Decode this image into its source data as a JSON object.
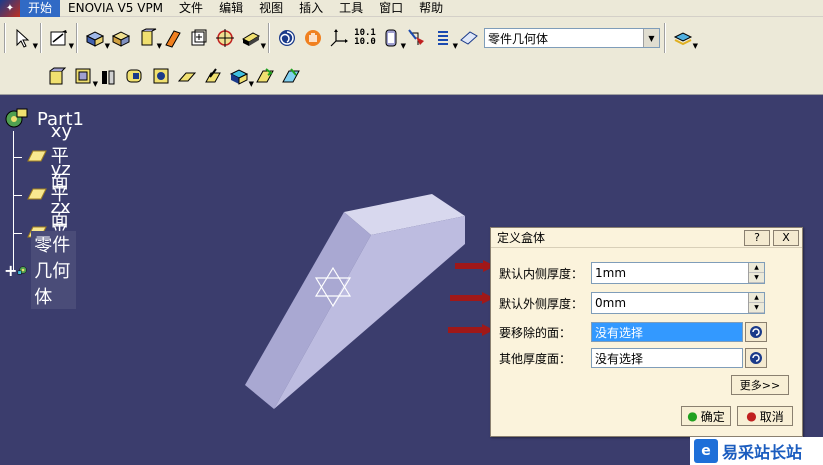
{
  "menubar": {
    "items": [
      "开始",
      "ENOVIA V5 VPM",
      "文件",
      "编辑",
      "视图",
      "插入",
      "工具",
      "窗口",
      "帮助"
    ]
  },
  "toolbar": {
    "text_icon_top": "10.1",
    "text_icon_bottom": "10.0",
    "body_combo_value": "零件几何体"
  },
  "tree": {
    "root": "Part1",
    "items": [
      "xy 平面",
      "yz 平面",
      "zx 平面",
      "零件几何体"
    ]
  },
  "dialog": {
    "title": "定义盒体",
    "help_button": "?",
    "close_button": "X",
    "inner_thickness_label": "默认内侧厚度：",
    "inner_thickness_value": "1mm",
    "outer_thickness_label": "默认外侧厚度：",
    "outer_thickness_value": "0mm",
    "faces_to_remove_label": "要移除的面：",
    "faces_to_remove_value": "没有选择",
    "other_thickness_label": "其他厚度面：",
    "other_thickness_value": "没有选择",
    "more_button": "更多>>",
    "ok_button": "确定",
    "cancel_button": "取消"
  },
  "watermark": {
    "text": "易采站长站"
  },
  "colors": {
    "viewport_bg": "#3b3d6d",
    "toolbar_bg": "#ece9d8",
    "dialog_bg": "#fbf3dc",
    "selected_field": "#3399ff",
    "arrow_red": "#a01818",
    "solid_face": "#b7b6dc"
  }
}
